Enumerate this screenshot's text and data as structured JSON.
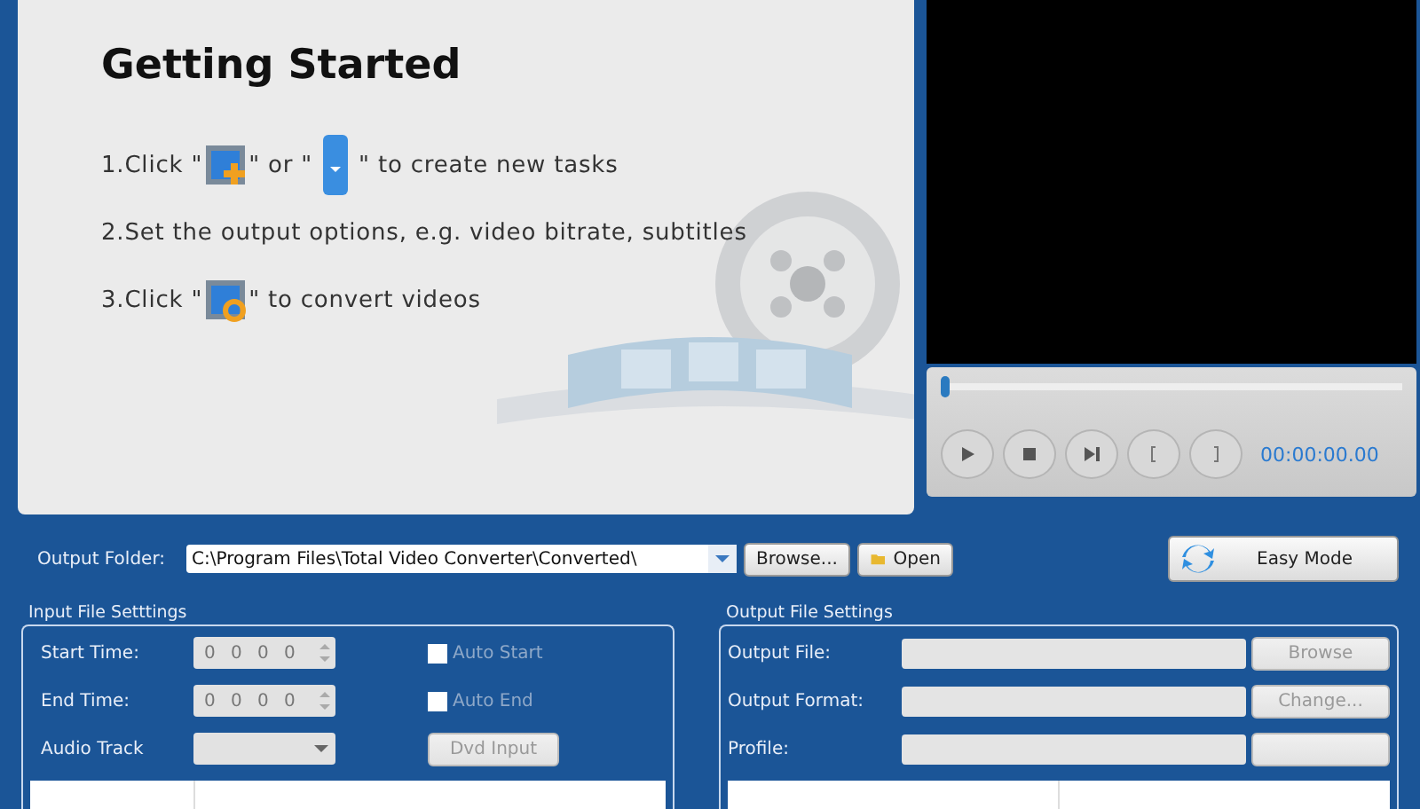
{
  "getting_started": {
    "title": "Getting Started",
    "steps": [
      {
        "parts": [
          {
            "kind": "text",
            "text": "1.Click \""
          },
          {
            "kind": "add"
          },
          {
            "kind": "text",
            "text": "\" or \""
          },
          {
            "kind": "dropdown"
          },
          {
            "kind": "text",
            "text": "\" to create new tasks"
          }
        ]
      },
      {
        "parts": [
          {
            "kind": "text",
            "text": "2.Set the output options, e.g. video bitrate, subtitles"
          }
        ]
      },
      {
        "parts": [
          {
            "kind": "text",
            "text": "3.Click \""
          },
          {
            "kind": "convert"
          },
          {
            "kind": "text",
            "text": "\" to convert videos"
          }
        ]
      }
    ]
  },
  "player": {
    "level": 0,
    "time": "00:00:00.00",
    "buttons": [
      {
        "kind": "play"
      },
      {
        "kind": "stop"
      },
      {
        "kind": "next"
      },
      {
        "kind": "mark-in"
      },
      {
        "kind": "mark-out"
      }
    ]
  },
  "output_folder": {
    "label": "Output Folder:",
    "value": "C:\\Program Files\\Total Video Converter\\Converted\\",
    "browse": "Browse...",
    "open": "Open",
    "easy_mode": "Easy Mode"
  },
  "input_settings": {
    "title": "Input File Setttings",
    "rows": [
      {
        "label": "Start Time:",
        "kind": "spinner",
        "values": [
          "0",
          "0",
          "0",
          "0"
        ],
        "disabled": true,
        "check": {
          "label": "Auto Start",
          "checked": false,
          "disabled": true
        }
      },
      {
        "label": "End Time:",
        "kind": "spinner",
        "values": [
          "0",
          "0",
          "0",
          "0"
        ],
        "disabled": true,
        "check": {
          "label": "Auto End",
          "checked": false,
          "disabled": true
        }
      },
      {
        "label": "Audio Track",
        "kind": "combo",
        "disabled": true,
        "button": {
          "label": "Dvd Input",
          "disabled": true
        }
      }
    ]
  },
  "output_settings": {
    "title": "Output File Settings",
    "rows": [
      {
        "label": "Output File:",
        "button": {
          "label": "Browse",
          "disabled": true
        }
      },
      {
        "label": "Output Format:",
        "button": {
          "label": "Change...",
          "disabled": true
        }
      },
      {
        "label": "Profile:",
        "button": {
          "disabled": true
        }
      }
    ]
  }
}
